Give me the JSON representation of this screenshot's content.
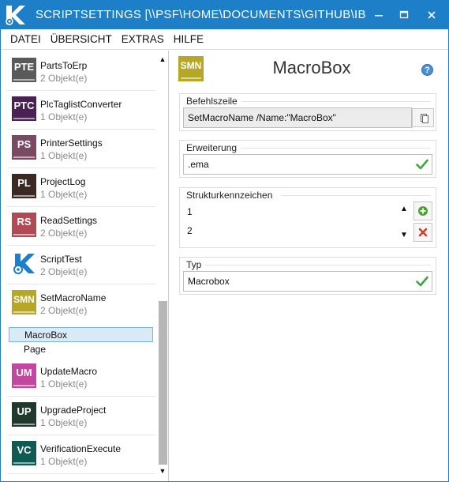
{
  "window": {
    "title": "SCRIPTSETTINGS [\\\\PSF\\HOME\\DOCUMENTS\\GITHUB\\IBKA...",
    "minimize_icon": "minimize-icon",
    "maximize_icon": "maximize-icon",
    "close_icon": "close-icon",
    "accent": "#1e7fc9"
  },
  "menu": [
    "DATEI",
    "ÜBERSICHT",
    "EXTRAS",
    "HILFE"
  ],
  "list": {
    "items": [
      {
        "abbr": "PTE",
        "name": "PartsToErp",
        "count": "2 Objekt(e)",
        "color": "#5a5a5a"
      },
      {
        "abbr": "PTC",
        "name": "PlcTaglistConverter",
        "count": "1 Objekt(e)",
        "color": "#4a2154"
      },
      {
        "abbr": "PS",
        "name": "PrinterSettings",
        "count": "1 Objekt(e)",
        "color": "#7a4a63"
      },
      {
        "abbr": "PL",
        "name": "ProjectLog",
        "count": "1 Objekt(e)",
        "color": "#3b2a23"
      },
      {
        "abbr": "RS",
        "name": "ReadSettings",
        "count": "2 Objekt(e)",
        "color": "#b04a55"
      },
      {
        "abbr": "",
        "name": "ScriptTest",
        "count": "2 Objekt(e)",
        "color": "#1e7fc9",
        "icon": "app-logo-icon"
      },
      {
        "abbr": "SMN",
        "name": "SetMacroName",
        "count": "2 Objekt(e)",
        "color": "#b6a824"
      },
      {
        "abbr": "UM",
        "name": "UpdateMacro",
        "count": "1 Objekt(e)",
        "color": "#c4479f"
      },
      {
        "abbr": "UP",
        "name": "UpgradeProject",
        "count": "1 Objekt(e)",
        "color": "#1f3a2c"
      },
      {
        "abbr": "VC",
        "name": "VerificationExecute",
        "count": "1 Objekt(e)",
        "color": "#0f5a52"
      }
    ],
    "sub_items": [
      "MacroBox",
      "Page"
    ],
    "selected": "MacroBox",
    "scroll_up_icon": "scroll-up-icon",
    "scroll_down_icon": "scroll-down-icon"
  },
  "detail": {
    "tile_abbr": "SMN",
    "title": "MacroBox",
    "help_icon": "help-icon",
    "befehlszeile": {
      "label": "Befehlszeile",
      "value": "SetMacroName /Name:\"MacroBox\""
    },
    "erweiterung": {
      "label": "Erweiterung",
      "value": ".ema"
    },
    "strukturkennzeichen": {
      "label": "Strukturkennzeichen",
      "values": [
        "1",
        "2"
      ]
    },
    "typ": {
      "label": "Typ",
      "value": "Macrobox"
    },
    "ok_color": "#3ea63e",
    "add_color": "#4aa52e",
    "remove_color": "#d63a2a"
  }
}
